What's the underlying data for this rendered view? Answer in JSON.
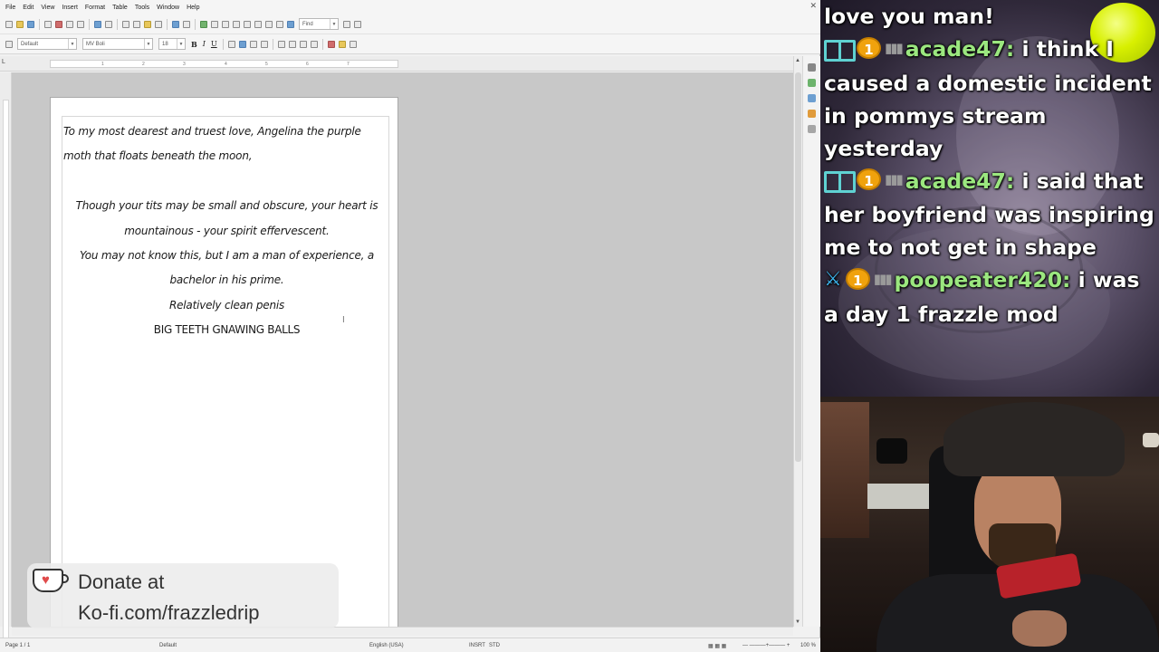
{
  "menus": [
    "File",
    "Edit",
    "View",
    "Insert",
    "Format",
    "Table",
    "Tools",
    "Window",
    "Help"
  ],
  "toolbar": {
    "find_placeholder": "Find",
    "style": "Default",
    "font": "MV Boli",
    "size": "18",
    "bold": "B",
    "italic": "I",
    "underline": "U"
  },
  "ruler": {
    "corner": "L",
    "ticks": [
      "1",
      "2",
      "3",
      "4",
      "5",
      "6",
      "7"
    ]
  },
  "document": {
    "paragraphs": [
      {
        "text": "To my most dearest and truest love, Angelina the purple moth that floats beneath the moon,",
        "align": "left"
      },
      {
        "text": "",
        "align": "blank"
      },
      {
        "text": "Though your tits may be small and obscure, your heart is mountainous - your spirit effervescent.",
        "align": "center"
      },
      {
        "text": "You may not know this, but I am a man of experience, a bachelor in his prime.",
        "align": "center"
      },
      {
        "text": "Relatively clean penis",
        "align": "center"
      },
      {
        "text": "BIG TEETH GNAWING BALLS",
        "align": "center"
      }
    ]
  },
  "statusbar": {
    "page": "Page 1 / 1",
    "style": "Default",
    "language": "English (USA)",
    "insert": "INSRT",
    "selection": "STD",
    "zoom": "100 %"
  },
  "donate": {
    "line1": "Donate at",
    "line2": "Ko-fi.com/frazzledrip"
  },
  "chat": {
    "messages": [
      {
        "badges": [],
        "user": "",
        "text": "love you man!"
      },
      {
        "badges": [
          "sub",
          "one",
          "bars"
        ],
        "user": "acade47:",
        "text": " i think I caused a domestic incident in pommys stream yesterday"
      },
      {
        "badges": [
          "sub",
          "one",
          "bars"
        ],
        "user": "acade47:",
        "text": " i said that her boyfriend was inspiring me to not get in shape"
      },
      {
        "badges": [
          "sword",
          "one",
          "bars"
        ],
        "user": "poopeater420:",
        "text": " i was a day 1 frazzle mod"
      }
    ]
  },
  "colors": {
    "chat_username": "#9be77f",
    "badge_gold": "#f0a20d",
    "badge_sub": "#5fd2d2",
    "mod_sword": "#3db7f0",
    "ball": "#d8f000"
  }
}
